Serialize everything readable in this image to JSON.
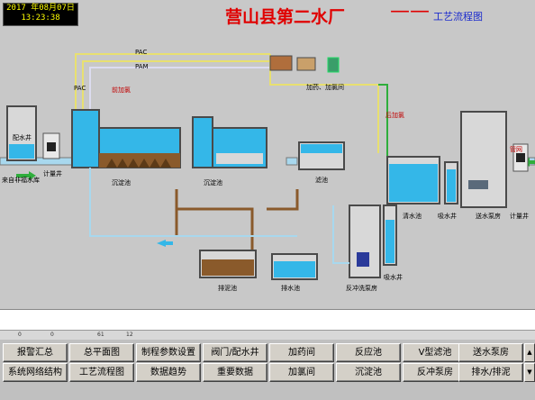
{
  "header": {
    "date": "2017 年08月07日",
    "time": "13:23:38",
    "title": "营山县第二水厂",
    "dash": "——",
    "subtitle": "工艺流程图"
  },
  "labels": {
    "pac": "PAC",
    "pam": "PAM",
    "pre_chlorine": "前加氯",
    "dosing_room": "加药、加氯间",
    "post_chlorine": "后加氯",
    "raw_well": "配水井",
    "water_source": "来自非福水库",
    "meter_well_in": "计量井",
    "sed_tank_1": "沉淀池",
    "sed_tank_2": "沉淀池",
    "filter": "滤池",
    "clear_well": "清水池",
    "suction_well": "吸水井",
    "delivery_pump": "送水泵房",
    "pipe_network": "管网",
    "meter_well_out": "计量井",
    "sludge_tank": "排泥池",
    "drain_tank": "排水池",
    "backwash_pump": "反冲洗泵房",
    "backwash_suction": "吸水井"
  },
  "toolstrip": [
    "0",
    "0",
    "61",
    "12"
  ],
  "nav": {
    "row1": [
      "报警汇总",
      "总平面图",
      "制程参数设置",
      "阀门/配水井",
      "加药间",
      "反应池",
      "V型滤池",
      "送水泵房"
    ],
    "row2": [
      "系统网络结构",
      "工艺流程图",
      "数据趋势",
      "重要数据",
      "加氯间",
      "沉淀池",
      "反冲泵房",
      "排水/排泥"
    ]
  },
  "colors": {
    "water": "#34b7e8",
    "wall": "#4a4a4a",
    "title": "#e00000",
    "sludge_pipe": "#8a5a2b",
    "chem_pipe": "#e8e070"
  }
}
